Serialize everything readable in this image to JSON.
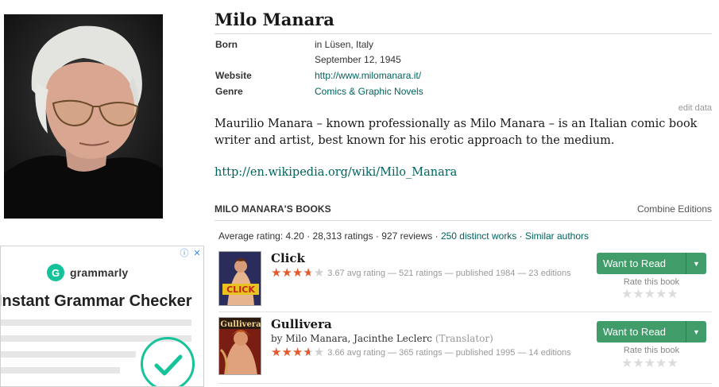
{
  "author": {
    "name": "Milo Manara",
    "born_label": "Born",
    "born_place": "in Lüsen, Italy",
    "born_date": "September 12, 1945",
    "website_label": "Website",
    "website": "http://www.milomanara.it/",
    "genre_label": "Genre",
    "genre": "Comics & Graphic Novels",
    "edit_data": "edit data",
    "bio": "Maurilio Manara – known professionally as Milo Manara – is an Italian comic book writer and artist, best known for his erotic approach to the medium.",
    "wiki_link": "http://en.wikipedia.org/wiki/Milo_Manara"
  },
  "books_section": {
    "heading": "MILO MANARA'S BOOKS",
    "combine": "Combine Editions",
    "stats_prefix": "Average rating: 4.20 · 28,313 ratings · 927 reviews · ",
    "distinct_works": "250 distinct works",
    "separator": " · ",
    "similar_authors": "Similar authors"
  },
  "books": [
    {
      "title": "Click",
      "byline_authors": "",
      "byline_role": "",
      "rating_stars": 3.67,
      "rating_text": "3.67 avg rating — 521 ratings — published 1984 — 23 editions",
      "want_to_read": "Want to Read",
      "rate_label": "Rate this book"
    },
    {
      "title": "Gullivera",
      "byline_authors": "by Milo Manara, Jacinthe Leclerc",
      "byline_role": "(Translator)",
      "rating_stars": 3.66,
      "rating_text": "3.66 avg rating — 365 ratings — published 1995 — 14 editions",
      "want_to_read": "Want to Read",
      "rate_label": "Rate this book"
    }
  ],
  "ad": {
    "brand": "grammarly",
    "brand_letter": "G",
    "headline": "Instant Grammar Checker",
    "info_icon": "ⓘ",
    "close_icon": "✕"
  },
  "colors": {
    "link": "#00635d",
    "button": "#409d69",
    "star": "#e15b2d",
    "grammarly": "#15c39a"
  }
}
